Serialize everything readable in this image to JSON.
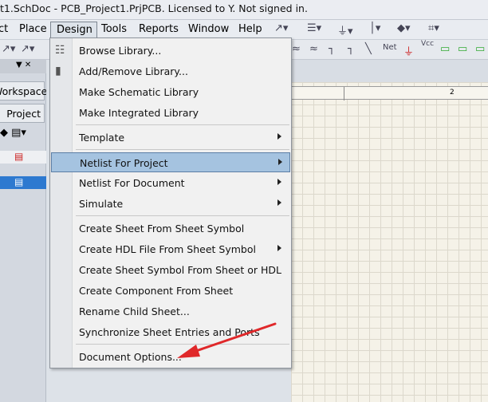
{
  "window": {
    "title": "t1.SchDoc - PCB_Project1.PrjPCB. Licensed to Y. Not signed in."
  },
  "menubar": {
    "items": [
      "ct",
      "Place",
      "Design",
      "Tools",
      "Reports",
      "Window",
      "Help"
    ]
  },
  "left_panel": {
    "workspace_label": "Workspace",
    "project_label": "Project"
  },
  "ruler": {
    "mark": "2"
  },
  "design_menu": {
    "items": [
      {
        "label": "Browse Library...",
        "icon": "books-icon",
        "submenu": false
      },
      {
        "label": "Add/Remove Library...",
        "icon": "library-book-icon",
        "submenu": false
      },
      {
        "label": "Make Schematic Library",
        "submenu": false
      },
      {
        "label": "Make Integrated Library",
        "submenu": false
      },
      {
        "label": "Template",
        "submenu": true
      },
      {
        "label": "Netlist For Project",
        "submenu": true,
        "highlighted": true
      },
      {
        "label": "Netlist For Document",
        "submenu": true
      },
      {
        "label": "Simulate",
        "submenu": true
      },
      {
        "label": "Create Sheet From Sheet Symbol",
        "submenu": false
      },
      {
        "label": "Create HDL File From Sheet Symbol",
        "submenu": true
      },
      {
        "label": "Create Sheet Symbol From Sheet or HDL",
        "submenu": false
      },
      {
        "label": "Create Component From Sheet",
        "submenu": false
      },
      {
        "label": "Rename Child Sheet...",
        "submenu": false
      },
      {
        "label": "Synchronize Sheet Entries and Ports",
        "submenu": false
      },
      {
        "label": "Document Options...",
        "submenu": false
      }
    ]
  },
  "annotation": {
    "color": "#e0282a"
  }
}
